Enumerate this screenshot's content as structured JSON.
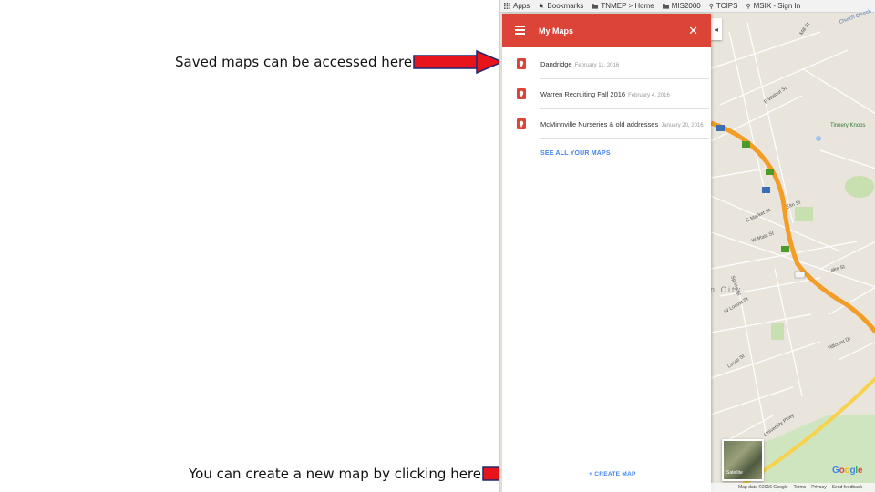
{
  "captions": {
    "saved_maps": "Saved maps can be accessed here:",
    "create_map": "You can create a new map by clicking here:"
  },
  "colors": {
    "arrow_red": "#e8141c",
    "header_red": "#db4437",
    "link_blue": "#4285f4",
    "highway_orange": "#f39c26",
    "yellow_road": "#f7d24a"
  },
  "bookmarks_bar": {
    "items": [
      {
        "icon": "apps-grid-icon",
        "label": "Apps"
      },
      {
        "icon": "star-icon",
        "label": "Bookmarks"
      },
      {
        "icon": "folder-icon",
        "label": "TNMEP > Home"
      },
      {
        "icon": "folder-icon",
        "label": "MIS2000"
      },
      {
        "icon": "link-icon",
        "label": "TCIPS"
      },
      {
        "icon": "link-icon",
        "label": "MSIX - Sign In"
      }
    ]
  },
  "panel": {
    "title": "My Maps",
    "maps": [
      {
        "name": "Dandridge",
        "date": "February 11, 2016"
      },
      {
        "name": "Warren Recruiting Fall 2016",
        "date": "February 4, 2016"
      },
      {
        "name": "McMinnville Nurseries & old addresses",
        "date": "January 20, 2016"
      }
    ],
    "see_all_label": "SEE ALL YOUR MAPS",
    "create_map_label": "+ CREATE MAP"
  },
  "map": {
    "collapse_symbol": "◂",
    "satellite_label": "Satellite",
    "google_logo": "Google",
    "city_fragment": "n City",
    "park_label": "Tinnery Knobs",
    "street_labels": [
      "Mill St",
      "Church Church",
      "W Locust St",
      "E Market St",
      "Spring St",
      "Lucas St",
      "W Main St",
      "University Pkwy",
      "E Walnut St",
      "Hillcrest Dr",
      "Elm St",
      "Lake St"
    ],
    "route_shields": [
      "23",
      "23",
      "23",
      "23",
      "67",
      "75"
    ],
    "footer": {
      "data": "Map data ©2016 Google",
      "terms": "Terms",
      "privacy": "Privacy",
      "report": "Send feedback"
    }
  }
}
